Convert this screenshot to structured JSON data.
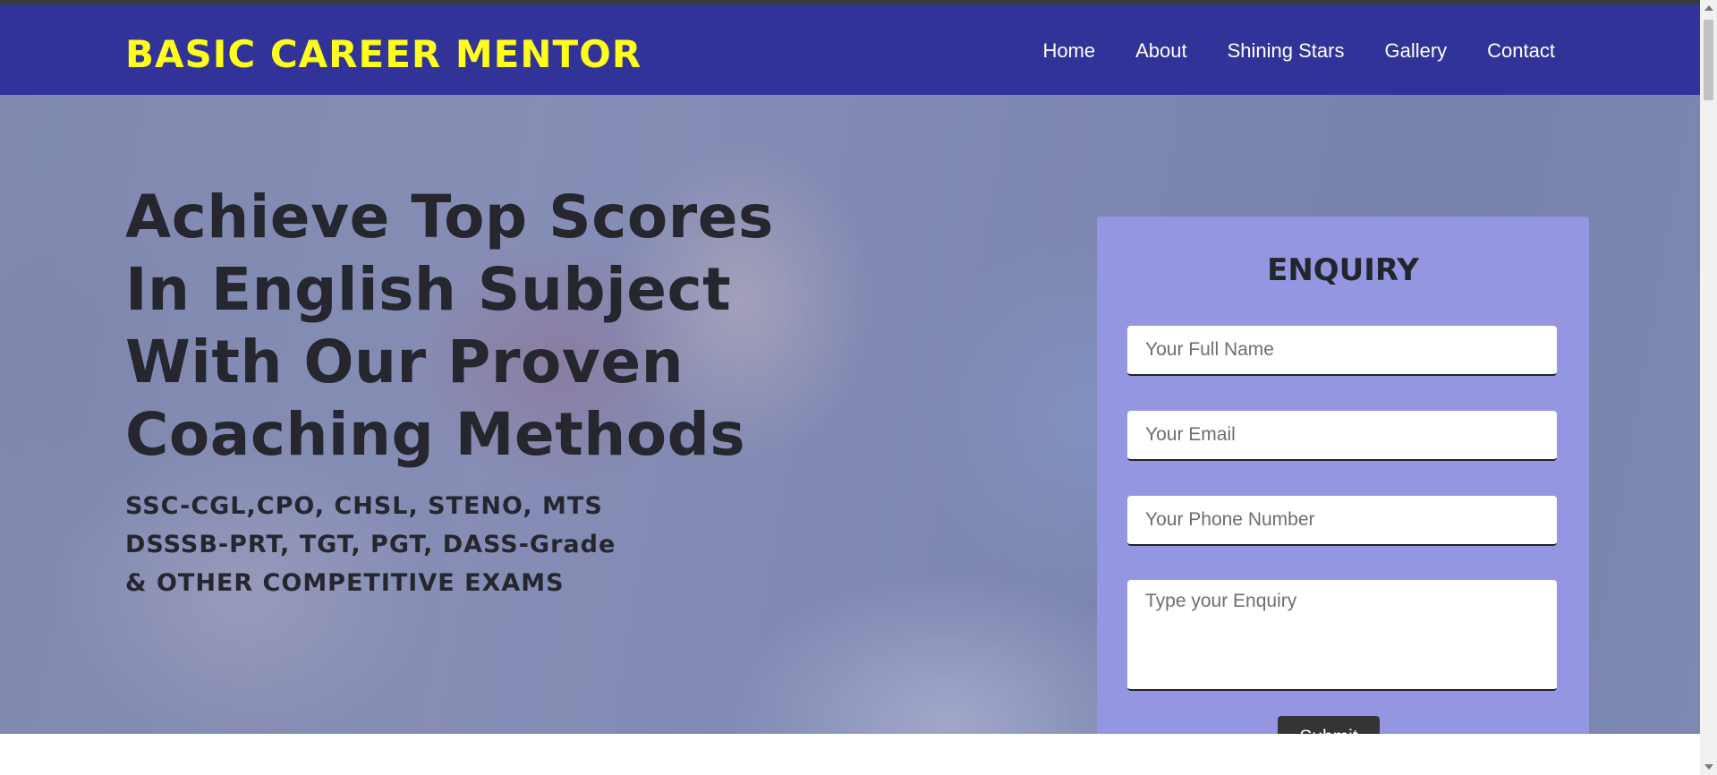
{
  "brand": {
    "name": "BASIC CAREER MENTOR"
  },
  "nav": {
    "items": [
      {
        "label": "Home"
      },
      {
        "label": "About"
      },
      {
        "label": "Shining Stars"
      },
      {
        "label": "Gallery"
      },
      {
        "label": "Contact"
      }
    ]
  },
  "hero": {
    "headline": "Achieve Top Scores In English Subject With Our Proven Coaching Methods",
    "exam_lines": [
      {
        "strong": "SSC",
        "rest": "-CGL,CPO, CHSL, STENO, MTS"
      },
      {
        "strong": "DSSSB",
        "rest": "-PRT, TGT, PGT, DASS-Grade"
      },
      {
        "strong": "",
        "rest": "& OTHER COMPETITIVE EXAMS"
      }
    ]
  },
  "enquiry_form": {
    "title": "ENQUIRY",
    "name_placeholder": "Your Full Name",
    "email_placeholder": "Your Email",
    "phone_placeholder": "Your Phone Number",
    "enquiry_placeholder": "Type your Enquiry",
    "submit_label": "Submit"
  },
  "colors": {
    "navbar_bg": "#313399",
    "brand_text": "#ffff1a",
    "form_panel_bg": "#9596e2",
    "submit_bg": "#333435"
  }
}
